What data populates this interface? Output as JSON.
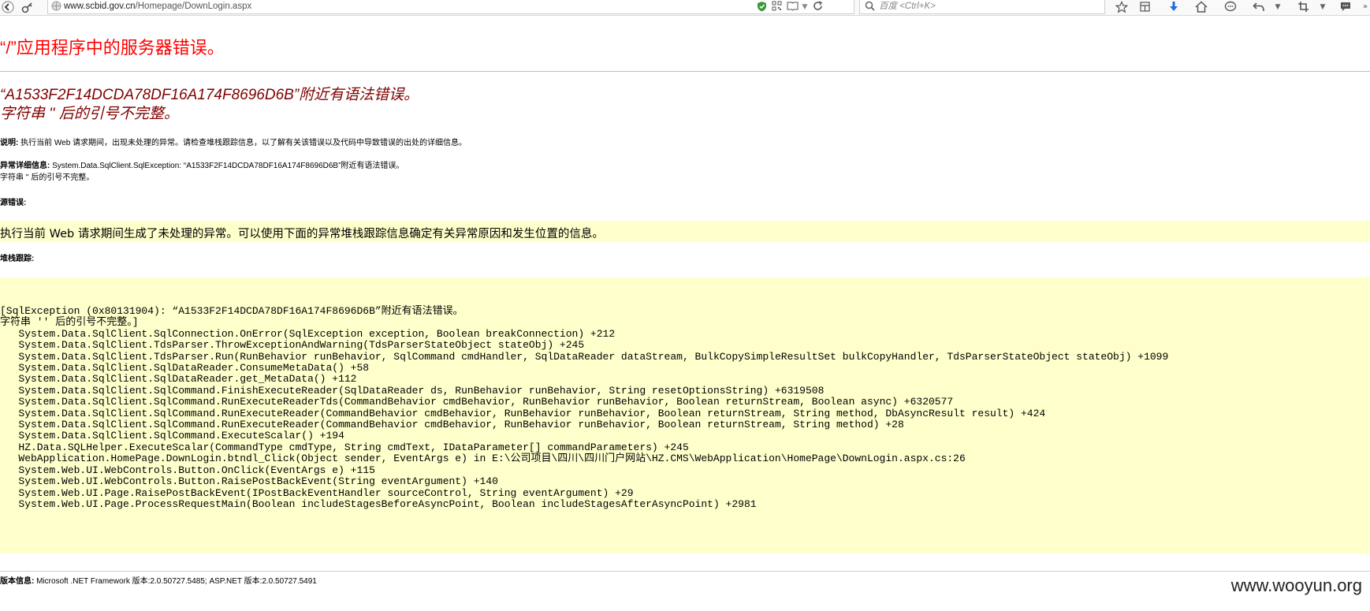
{
  "browser": {
    "url_domain": "www.scbid.gov.cn",
    "url_path": "/Homepage/DownLogin.aspx",
    "search_placeholder": "百度 <Ctrl+K>"
  },
  "page": {
    "title": "“/”应用程序中的服务器错误。",
    "error_line1": "“A1533F2F14DCDA78DF16A174F8696D6B”附近有语法错误。",
    "error_line2": "字符串 '' 后的引号不完整。",
    "description_label": "说明:",
    "description_text": " 执行当前 Web 请求期间，出现未处理的异常。请检查堆栈跟踪信息，以了解有关该错误以及代码中导致错误的出处的详细信息。",
    "exception_label": "异常详细信息:",
    "exception_text": " System.Data.SqlClient.SqlException: “A1533F2F14DCDA78DF16A174F8696D6B”附近有语法错误。",
    "exception_text2": "字符串 '' 后的引号不完整。",
    "source_error_label": "源错误:",
    "source_error_msg": "执行当前 Web 请求期间生成了未处理的异常。可以使用下面的异常堆栈跟踪信息确定有关异常原因和发生位置的信息。",
    "stack_label": "堆栈跟踪:",
    "stack_trace": "[SqlException (0x80131904): “A1533F2F14DCDA78DF16A174F8696D6B”附近有语法错误。\n字符串 '' 后的引号不完整。]\n   System.Data.SqlClient.SqlConnection.OnError(SqlException exception, Boolean breakConnection) +212\n   System.Data.SqlClient.TdsParser.ThrowExceptionAndWarning(TdsParserStateObject stateObj) +245\n   System.Data.SqlClient.TdsParser.Run(RunBehavior runBehavior, SqlCommand cmdHandler, SqlDataReader dataStream, BulkCopySimpleResultSet bulkCopyHandler, TdsParserStateObject stateObj) +1099\n   System.Data.SqlClient.SqlDataReader.ConsumeMetaData() +58\n   System.Data.SqlClient.SqlDataReader.get_MetaData() +112\n   System.Data.SqlClient.SqlCommand.FinishExecuteReader(SqlDataReader ds, RunBehavior runBehavior, String resetOptionsString) +6319508\n   System.Data.SqlClient.SqlCommand.RunExecuteReaderTds(CommandBehavior cmdBehavior, RunBehavior runBehavior, Boolean returnStream, Boolean async) +6320577\n   System.Data.SqlClient.SqlCommand.RunExecuteReader(CommandBehavior cmdBehavior, RunBehavior runBehavior, Boolean returnStream, String method, DbAsyncResult result) +424\n   System.Data.SqlClient.SqlCommand.RunExecuteReader(CommandBehavior cmdBehavior, RunBehavior runBehavior, Boolean returnStream, String method) +28\n   System.Data.SqlClient.SqlCommand.ExecuteScalar() +194\n   HZ.Data.SQLHelper.ExecuteScalar(CommandType cmdType, String cmdText, IDataParameter[] commandParameters) +245\n   WebApplication.HomePage.DownLogin.btndl_Click(Object sender, EventArgs e) in E:\\公司项目\\四川\\四川门户网站\\HZ.CMS\\WebApplication\\HomePage\\DownLogin.aspx.cs:26\n   System.Web.UI.WebControls.Button.OnClick(EventArgs e) +115\n   System.Web.UI.WebControls.Button.RaisePostBackEvent(String eventArgument) +140\n   System.Web.UI.Page.RaisePostBackEvent(IPostBackEventHandler sourceControl, String eventArgument) +29\n   System.Web.UI.Page.ProcessRequestMain(Boolean includeStagesBeforeAsyncPoint, Boolean includeStagesAfterAsyncPoint) +2981",
    "version_label": "版本信息:",
    "version_text": " Microsoft .NET Framework 版本:2.0.50727.5485; ASP.NET 版本:2.0.50727.5491"
  },
  "watermark": "www.wooyun.org",
  "colors": {
    "title_red": "#ff0000",
    "subtitle_maroon": "#800000",
    "code_background": "#ffffcc"
  },
  "icons": [
    "back-icon",
    "key-icon",
    "globe-icon",
    "shield-icon",
    "qr-icon",
    "reader-icon",
    "dropdown-icon",
    "reload-icon",
    "search-icon",
    "star-icon",
    "library-icon",
    "download-icon",
    "home-icon",
    "chat-icon",
    "undo-icon",
    "crop-icon",
    "comment-icon"
  ]
}
